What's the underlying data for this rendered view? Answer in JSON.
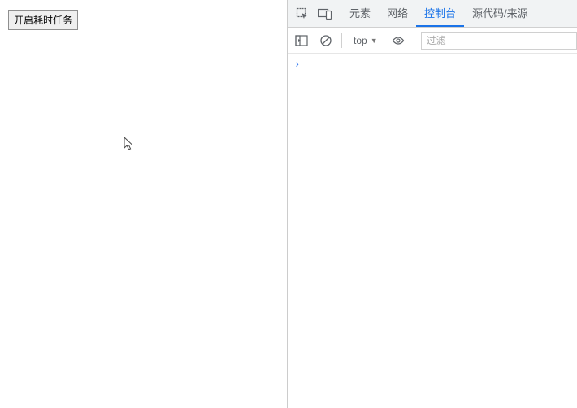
{
  "left": {
    "button_label": "开启耗时任务"
  },
  "devtools": {
    "tabs": [
      {
        "id": "elements",
        "label": "元素",
        "active": false
      },
      {
        "id": "network",
        "label": "网络",
        "active": false
      },
      {
        "id": "console",
        "label": "控制台",
        "active": true
      },
      {
        "id": "sources",
        "label": "源代码/来源",
        "active": false
      }
    ],
    "context_label": "top",
    "filter_placeholder": "过滤",
    "prompt": "›"
  }
}
